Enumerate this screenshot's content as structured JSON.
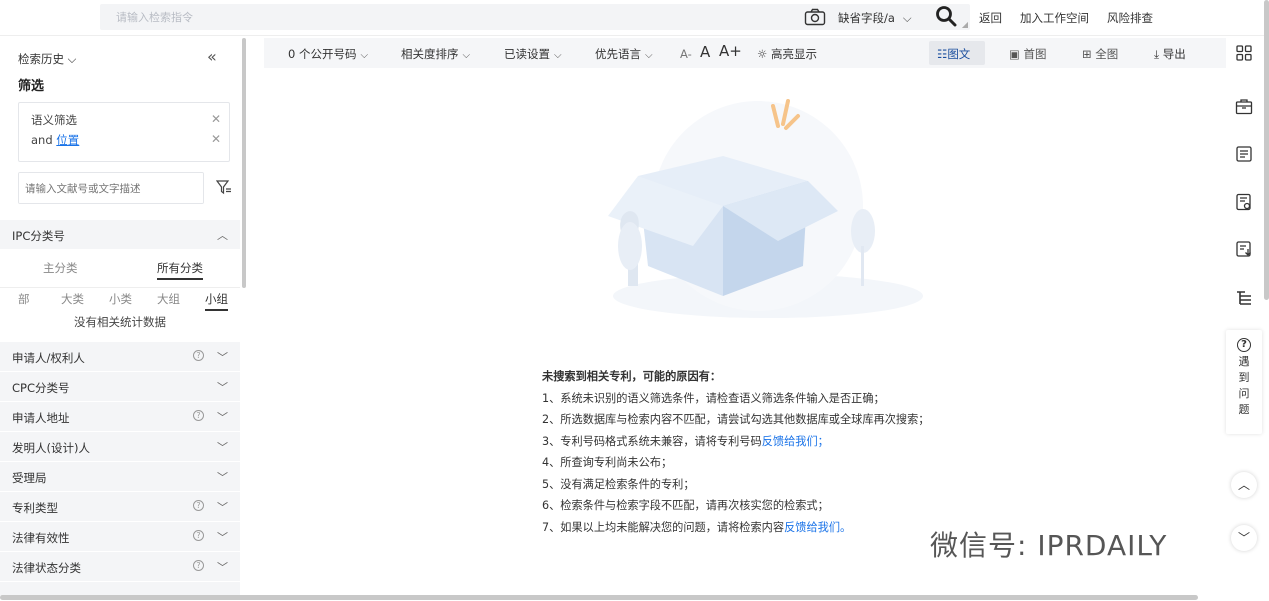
{
  "search": {
    "placeholder": "请输入检索指令",
    "field": "缺省字段/a"
  },
  "top_links": [
    "返回",
    "加入工作空间",
    "风险排查"
  ],
  "sidebar": {
    "history_label": "检索历史",
    "filter_title": "筛选",
    "chips": [
      {
        "text": "语义筛选",
        "link": ""
      },
      {
        "text": "and ",
        "link": "位置"
      }
    ],
    "desc_placeholder": "请输入文献号或文字描述",
    "ipc": {
      "label": "IPC分类号",
      "tabs": [
        "主分类",
        "所有分类"
      ],
      "active_tab": "所有分类",
      "levels": [
        "部",
        "大类",
        "小类",
        "大组",
        "小组"
      ],
      "active_level": "小组",
      "no_data": "没有相关统计数据"
    },
    "groups": [
      {
        "label": "申请人/权利人",
        "help": true
      },
      {
        "label": "CPC分类号",
        "help": false
      },
      {
        "label": "申请人地址",
        "help": true
      },
      {
        "label": "发明人(设计)人",
        "help": false
      },
      {
        "label": "受理局",
        "help": false
      },
      {
        "label": "专利类型",
        "help": true
      },
      {
        "label": "法律有效性",
        "help": true
      },
      {
        "label": "法律状态分类",
        "help": true
      }
    ]
  },
  "toolbar": {
    "public_count": "0 个公开号码",
    "sort": "相关度排序",
    "read_settings": "已读设置",
    "language": "优先语言",
    "font_small": "A-",
    "font_normal": "A",
    "font_large": "A+",
    "highlight": "高亮显示",
    "view_text_image": "图文",
    "view_first": "首图",
    "view_all": "全图",
    "export": "导出"
  },
  "empty": {
    "title": "未搜索到相关专利，可能的原因有：",
    "reasons": [
      {
        "text": "1、系统未识别的语义筛选条件，请检查语义筛选条件输入是否正确；",
        "link": ""
      },
      {
        "text": "2、所选数据库与检索内容不匹配，请尝试勾选其他数据库或全球库再次搜索；",
        "link": ""
      },
      {
        "text": "3、专利号码格式系统未兼容，请将专利号码",
        "link": "反馈给我们；"
      },
      {
        "text": "4、所查询专利尚未公布；",
        "link": ""
      },
      {
        "text": "5、没有满足检索条件的专利；",
        "link": ""
      },
      {
        "text": "6、检索条件与检索字段不匹配，请再次核实您的检索式；",
        "link": ""
      },
      {
        "text": "7、如果以上均未能解决您的问题，请将检索内容",
        "link": "反馈给我们。"
      }
    ]
  },
  "help": {
    "label": "遇到问题"
  },
  "watermark": "微信号: IPRDAILY",
  "colors": {
    "link": "#1a73e8",
    "toolbar_bg": "#f5f6f8",
    "group_bg": "#f4f5f7"
  },
  "icons": [
    "camera-icon",
    "search-icon",
    "filter-funnel-icon",
    "grid-icon",
    "briefcase-icon",
    "document-icon",
    "report-icon",
    "export-doc-icon",
    "list-tree-icon",
    "question-icon",
    "chevron-up-icon",
    "chevron-down-icon"
  ]
}
